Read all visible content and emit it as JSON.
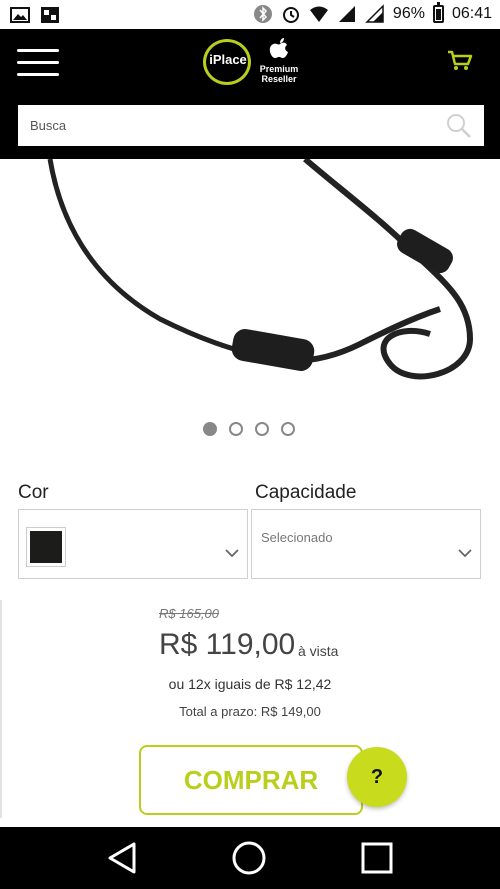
{
  "status_bar": {
    "battery": "96%",
    "time": "06:41",
    "left_icons": [
      "image-icon",
      "app-notification-icon"
    ],
    "right_icons": [
      "bluetooth-icon",
      "alarm-icon",
      "wifi-icon",
      "signal-3g-icon",
      "signal-4g-icon",
      "battery-icon"
    ]
  },
  "header": {
    "logo_text": "iPlace",
    "reseller_line1": "Premium",
    "reseller_line2": "Reseller",
    "accent_color": "#b9cf1c"
  },
  "search": {
    "placeholder": "Busca"
  },
  "carousel": {
    "count": 4,
    "active_index": 0
  },
  "options": {
    "color_label": "Cor",
    "color_swatch": "#1c1c1a",
    "capacity_label": "Capacidade",
    "capacity_placeholder": "Selecionado"
  },
  "price": {
    "old": "R$ 165,00",
    "current": "R$ 119,00",
    "suffix": "à vista",
    "installments": "ou 12x iguais de R$ 12,42",
    "total": "Total a prazo: R$ 149,00"
  },
  "actions": {
    "buy_label": "COMPRAR",
    "help_label": "?"
  },
  "nav": {
    "items": [
      "back-icon",
      "home-icon",
      "recents-icon"
    ]
  }
}
